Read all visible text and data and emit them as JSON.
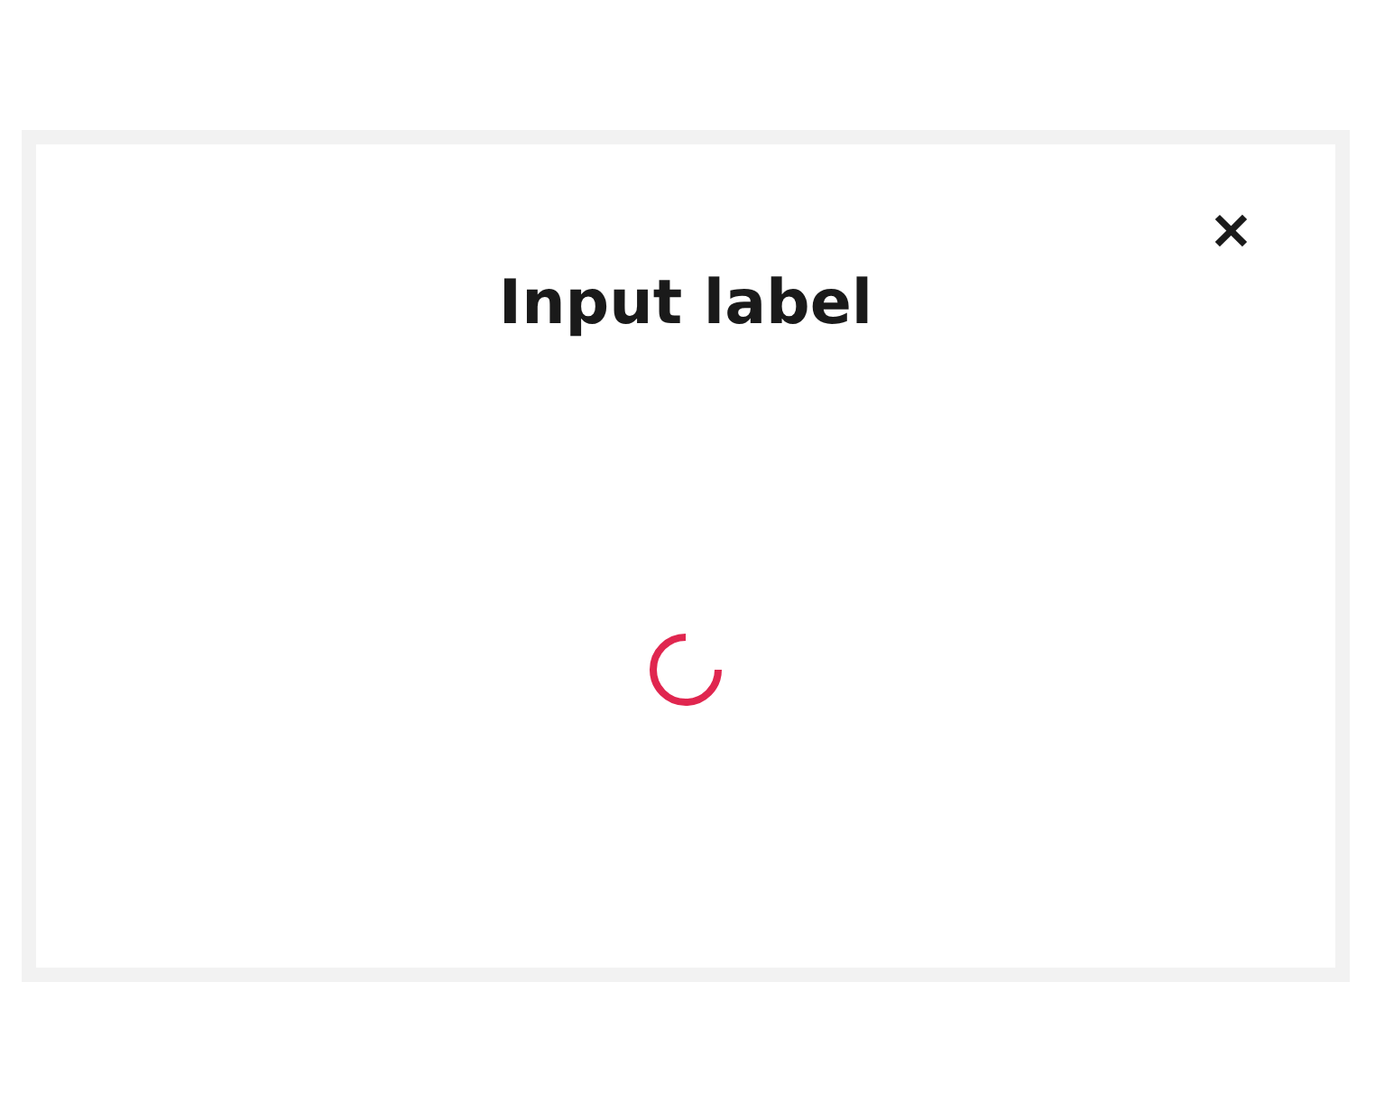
{
  "dialog": {
    "title": "Input label",
    "close_label": "✕",
    "loading": true
  }
}
